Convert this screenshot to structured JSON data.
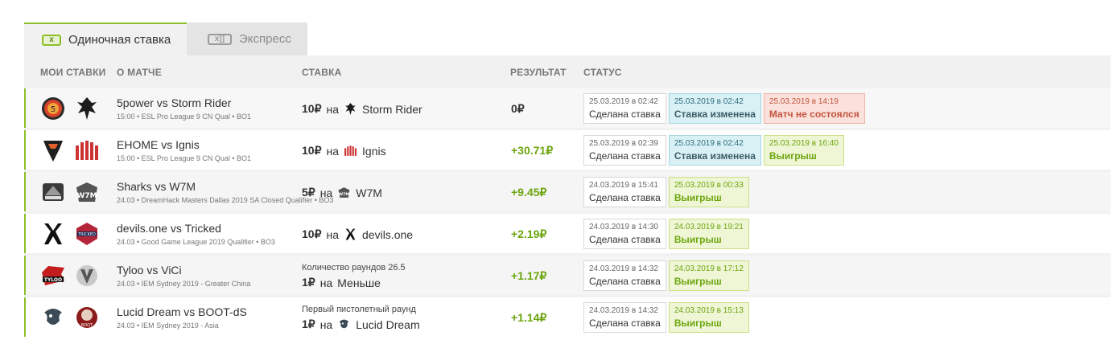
{
  "tabs": [
    {
      "label": "Одиночная ставка",
      "icon": "x",
      "active": true
    },
    {
      "label": "Экспресс",
      "icon": "x]]",
      "active": false
    }
  ],
  "headers": {
    "my_bets": "МОИ СТАВКИ",
    "about": "О МАТЧЕ",
    "bet": "СТАВКА",
    "result": "РЕЗУЛЬТАТ",
    "status": "СТАТУС"
  },
  "currency": "₽",
  "rows": [
    {
      "match": "5power vs Storm Rider",
      "sub": "15:00 • ESL Pro League 9 CN Qual • BO1",
      "bet_desc": "",
      "bet_amount": "10₽",
      "bet_on": "на",
      "bet_team": "Storm Rider",
      "result": "0₽",
      "statuses": [
        {
          "date": "25.03.2019 в 02:42",
          "label": "Сделана ставка",
          "kind": "placed"
        },
        {
          "date": "25.03.2019 в 02:42",
          "label": "Ставка изменена",
          "kind": "changed"
        },
        {
          "date": "25.03.2019 в 14:19",
          "label": "Матч не состоялся",
          "kind": "cancel"
        }
      ]
    },
    {
      "match": "EHOME vs Ignis",
      "sub": "15:00 • ESL Pro League 9 CN Qual • BO1",
      "bet_desc": "",
      "bet_amount": "10₽",
      "bet_on": "на",
      "bet_team": "Ignis",
      "result": "+30.71₽",
      "statuses": [
        {
          "date": "25.03.2019 в 02:39",
          "label": "Сделана ставка",
          "kind": "placed"
        },
        {
          "date": "25.03.2019 в 02:42",
          "label": "Ставка изменена",
          "kind": "changed"
        },
        {
          "date": "25.03.2019 в 16:40",
          "label": "Выигрыш",
          "kind": "won"
        }
      ]
    },
    {
      "match": "Sharks vs W7M",
      "sub": "24.03 • DreamHack Masters Dallas 2019 SA Closed Qualifier • BO3",
      "bet_desc": "",
      "bet_amount": "5₽",
      "bet_on": "на",
      "bet_team": "W7M",
      "result": "+9.45₽",
      "statuses": [
        {
          "date": "24.03.2019 в 15:41",
          "label": "Сделана ставка",
          "kind": "placed"
        },
        {
          "date": "25.03.2019 в 00:33",
          "label": "Выигрыш",
          "kind": "won"
        }
      ]
    },
    {
      "match": "devils.one vs Tricked",
      "sub": "24.03 • Good Game League 2019 Qualifier • BO3",
      "bet_desc": "",
      "bet_amount": "10₽",
      "bet_on": "на",
      "bet_team": "devils.one",
      "result": "+2.19₽",
      "statuses": [
        {
          "date": "24.03.2019 в 14:30",
          "label": "Сделана ставка",
          "kind": "placed"
        },
        {
          "date": "24.03.2019 в 19:21",
          "label": "Выигрыш",
          "kind": "won"
        }
      ]
    },
    {
      "match": "Tyloo vs ViCi",
      "sub": "24.03 • IEM Sydney 2019 - Greater China",
      "bet_desc": "Количество раундов 26.5",
      "bet_amount": "1₽",
      "bet_on": "на",
      "bet_team": "Меньше",
      "result": "+1.17₽",
      "statuses": [
        {
          "date": "24.03.2019 в 14:32",
          "label": "Сделана ставка",
          "kind": "placed"
        },
        {
          "date": "24.03.2019 в 17:12",
          "label": "Выигрыш",
          "kind": "won"
        }
      ]
    },
    {
      "match": "Lucid Dream vs BOOT-dS",
      "sub": "24.03 • IEM Sydney 2019 - Asia",
      "bet_desc": "Первый пистолетный раунд",
      "bet_amount": "1₽",
      "bet_on": "на",
      "bet_team": "Lucid Dream",
      "result": "+1.14₽",
      "statuses": [
        {
          "date": "24.03.2019 в 14:32",
          "label": "Сделана ставка",
          "kind": "placed"
        },
        {
          "date": "24.03.2019 в 15:13",
          "label": "Выигрыш",
          "kind": "won"
        }
      ]
    }
  ],
  "logos": [
    [
      "5power-logo-icon",
      "storm-rider-logo-icon"
    ],
    [
      "ehome-logo-icon",
      "ignis-logo-icon"
    ],
    [
      "sharks-logo-icon",
      "w7m-logo-icon"
    ],
    [
      "devils-one-logo-icon",
      "tricked-logo-icon"
    ],
    [
      "tyloo-logo-icon",
      "vici-logo-icon"
    ],
    [
      "lucid-dream-logo-icon",
      "boot-ds-logo-icon"
    ]
  ],
  "colors": {
    "accent": "#8cbf26",
    "win": "#6da50f",
    "cancel": "#c4533d",
    "changed": "#d9f0f5"
  }
}
